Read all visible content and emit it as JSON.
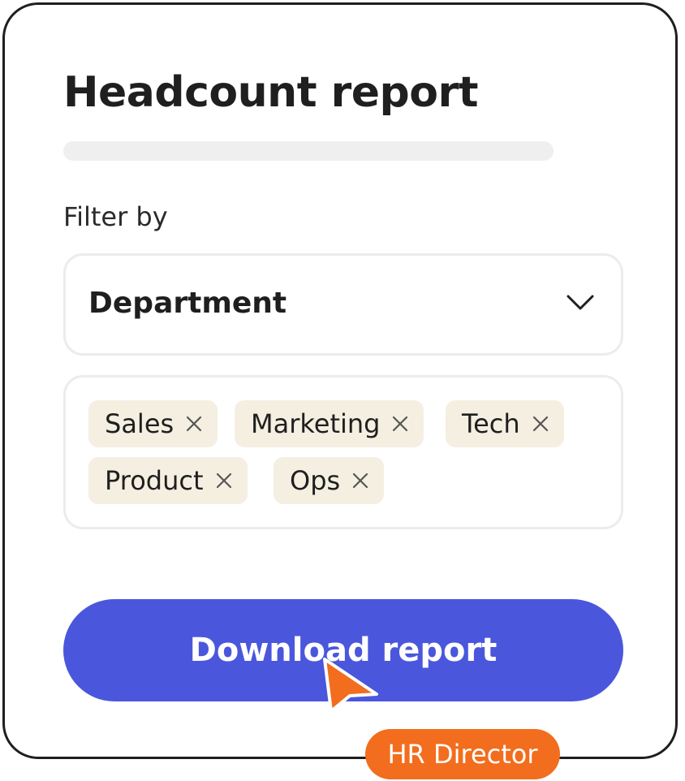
{
  "report": {
    "title": "Headcount report",
    "filter_label": "Filter by",
    "filter_select": {
      "value": "Department"
    },
    "tags": [
      {
        "label": "Sales"
      },
      {
        "label": "Marketing"
      },
      {
        "label": "Tech"
      },
      {
        "label": "Product"
      },
      {
        "label": "Ops"
      }
    ],
    "download_label": "Download report"
  },
  "user": {
    "role_badge": "HR Director"
  },
  "colors": {
    "accent": "#4a57dc",
    "tag_background": "#f5efe2",
    "badge": "#f26d1d",
    "cursor": "#f26d1d"
  },
  "icons": {
    "select": "chevron-down-icon",
    "tag_remove": "close-icon",
    "pointer": "mouse-pointer-icon"
  }
}
